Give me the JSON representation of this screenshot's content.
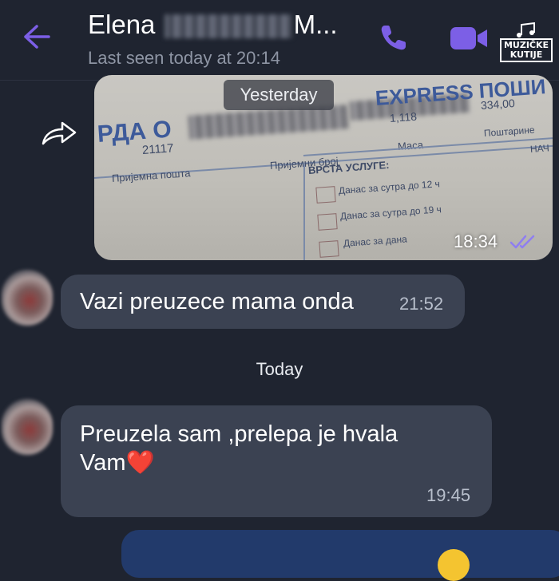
{
  "header": {
    "contact_name_start": "Elena",
    "contact_name_end": "M...",
    "last_seen": "Last seen today at 20:14",
    "icons": {
      "back": "back-arrow-icon",
      "call": "phone-icon",
      "video": "video-camera-icon"
    },
    "logo_text_1": "MUZIČKE",
    "logo_text_2": "KUTIJE",
    "accent_color": "#7c5fe6"
  },
  "messages": {
    "image": {
      "date_label": "Yesterday",
      "time": "18:34",
      "status_icon": "double-check-icon",
      "forward_icon": "forward-icon",
      "doc_texts": {
        "heading_left": "РДА О",
        "heading_right": "EXPRESS ПОШИ",
        "num1": "21117",
        "num2": "1,118",
        "amount": "334,00",
        "label_posta": "Пријемна пошта",
        "label_broj": "Пријемни број",
        "label_masa": "Маса",
        "label_postarina": "Поштарине",
        "label_vrsta": "ВРСТА УСЛУГЕ:",
        "opt1": "Данас за сутра до 12 ч",
        "opt2": "Данас за сутра до 19 ч",
        "opt3": "Данас за дана",
        "nac": "НАЧ"
      }
    },
    "msg1": {
      "text": "Vazi preuzece mama onda",
      "time": "21:52"
    },
    "date_today": "Today",
    "msg2": {
      "line1": "Preuzela sam ,prelepa je hvala",
      "line2": "Vam",
      "heart": "❤️",
      "time": "19:45"
    }
  }
}
